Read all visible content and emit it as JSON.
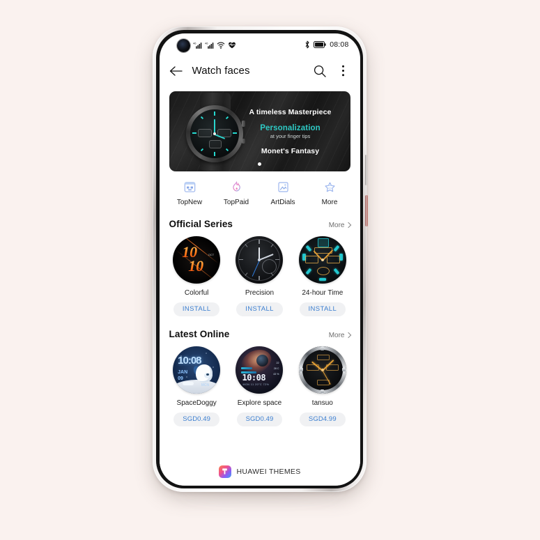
{
  "status_bar": {
    "time": "08:08",
    "icons": [
      "signal-icon-sim1",
      "signal-icon-sim2",
      "wifi-icon",
      "heart-rate-icon",
      "bluetooth-icon",
      "battery-icon"
    ]
  },
  "app_bar": {
    "back_icon": "back-arrow-icon",
    "title": "Watch faces",
    "search_icon": "search-icon",
    "overflow_icon": "more-vertical-icon"
  },
  "banner": {
    "line1": "A timeless Masterpiece",
    "line2": "Personalization",
    "line3": "at your finger tips",
    "line4": "Monet's Fantasy",
    "accent_color": "#2ec9c4",
    "page_indicator_count": 1,
    "active_page": 1
  },
  "quick_links": [
    {
      "label": "TopNew",
      "icon": "new-release-icon"
    },
    {
      "label": "TopPaid",
      "icon": "flame-icon"
    },
    {
      "label": "ArtDials",
      "icon": "art-picture-icon"
    },
    {
      "label": "More",
      "icon": "star-outline-icon"
    }
  ],
  "sections": [
    {
      "title": "Official Series",
      "more_label": "More",
      "more_icon": "chevron-right-icon",
      "items": [
        {
          "name": "Colorful",
          "action": "INSTALL"
        },
        {
          "name": "Precision",
          "action": "INSTALL"
        },
        {
          "name": "24-hour Time",
          "action": "INSTALL"
        }
      ]
    },
    {
      "title": "Latest Online",
      "more_label": "More",
      "more_icon": "chevron-right-icon",
      "items": [
        {
          "name": "SpaceDoggy",
          "action": "SGD0.49"
        },
        {
          "name": "Explore space",
          "action": "SGD0.49"
        },
        {
          "name": "tansuo",
          "action": "SGD4.99"
        }
      ]
    }
  ],
  "footer": {
    "icon": "huawei-themes-icon",
    "label": "HUAWEI THEMES"
  },
  "watch_face_art": {
    "colorful_digits_top": "10",
    "colorful_digits_bottom": "10",
    "colorful_tiny": "OCT",
    "space_time": "10:08",
    "space_date": "JAN",
    "space_day": "09",
    "space_brand": "MCN",
    "explore_time": "10:08",
    "explore_sub": "MON 11  20°C  72%"
  },
  "device": {
    "power_button_color": "#b5736d",
    "volume_button_color": "#b3aeac"
  }
}
